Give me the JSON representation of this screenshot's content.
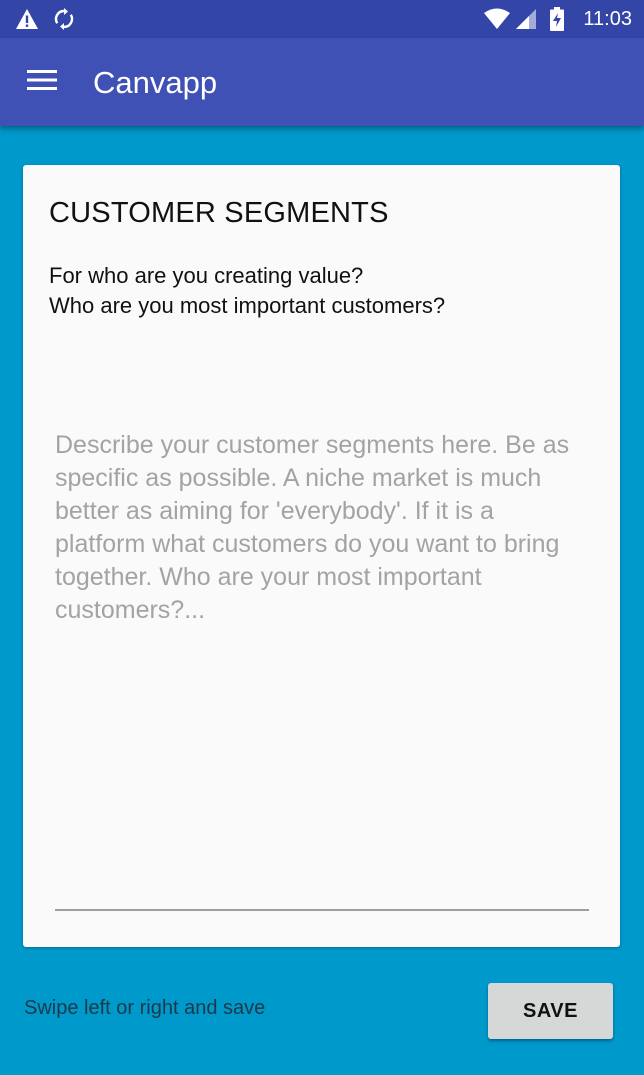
{
  "status_bar": {
    "time": "11:03",
    "icons": [
      "warning-icon",
      "sync-icon",
      "wifi-icon",
      "cell-signal-icon",
      "battery-charging-icon"
    ]
  },
  "app_bar": {
    "title": "Canvapp",
    "menu_icon": "hamburger-menu-icon"
  },
  "card": {
    "title": "CUSTOMER SEGMENTS",
    "question_line_1": "For who are you creating value?",
    "question_line_2": "Who are you most important customers?",
    "description_value": "",
    "description_placeholder": "Describe your customer segments here. Be as specific as possible. A niche market is much better as aiming for 'everybody'. If it is a platform what customers do you want to bring together. Who are your most important customers?..."
  },
  "footer": {
    "hint": "Swipe left or right and save",
    "save_label": "SAVE"
  },
  "colors": {
    "status_bar": "#3346a8",
    "app_bar": "#3f51b5",
    "background": "#0099cc",
    "card": "#fafafa",
    "save_button": "#d6d7d7"
  }
}
